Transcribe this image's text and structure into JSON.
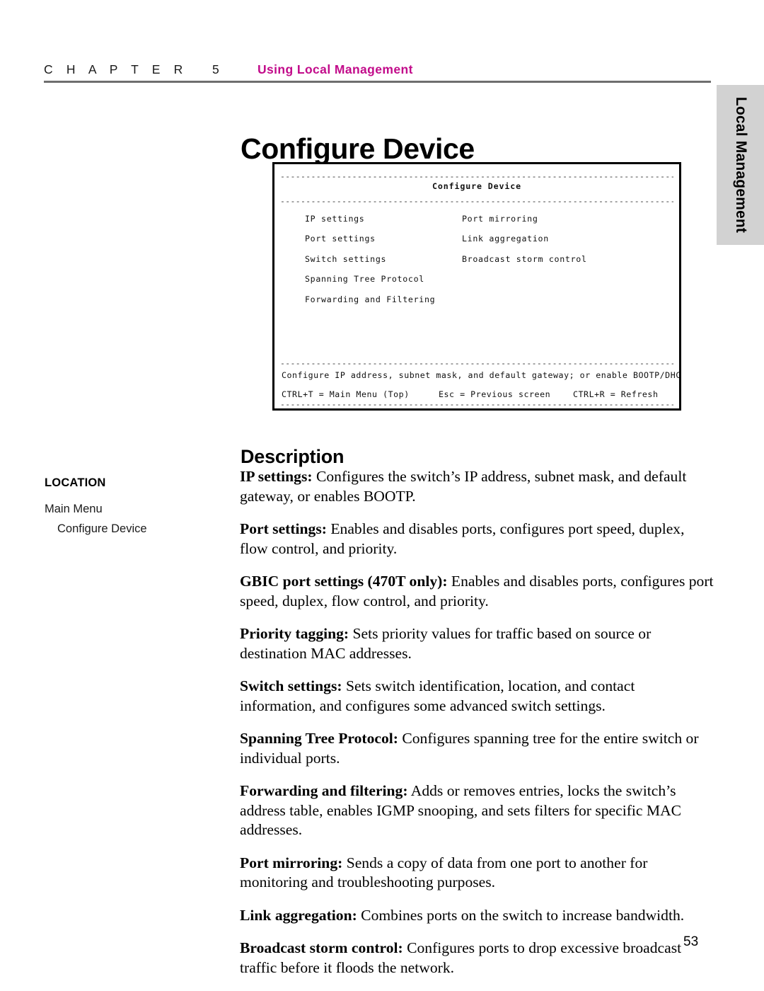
{
  "header": {
    "chapter_word": "C H A P T E R",
    "chapter_number": "5",
    "chapter_title": "Using Local Management",
    "accent_color": "#C20B8A",
    "rule_color": "#6E6E6E"
  },
  "side_tab": {
    "label": "Local Management",
    "background": "#D2D2D2"
  },
  "page_title": "Configure Device",
  "terminal": {
    "title": "Configure Device",
    "separator": "----------------------------------------------------------------------------------",
    "menu_left": [
      "IP settings",
      "Port settings",
      "Switch settings",
      "Spanning Tree Protocol",
      "Forwarding and Filtering"
    ],
    "menu_right": [
      "Port mirroring",
      "Link aggregation",
      "Broadcast storm control"
    ],
    "status_description": "Configure IP address, subnet mask, and default gateway; or enable BOOTP/DHCP.",
    "keys": [
      "CTRL+T = Main Menu (Top)",
      "Esc = Previous screen",
      "CTRL+R = Refresh"
    ]
  },
  "description": {
    "heading": "Description",
    "paragraphs": [
      {
        "term": "IP settings:",
        "text": " Configures the switch’s IP address, subnet mask, and default gateway, or enables BOOTP."
      },
      {
        "term": "Port settings:",
        "text": " Enables and disables ports, configures port speed, duplex, flow control, and priority."
      },
      {
        "term": "GBIC port settings (470T only):",
        "text": " Enables and disables ports, configures port speed, duplex, flow control, and priority."
      },
      {
        "term": "Priority tagging:",
        "text": " Sets priority values for traffic based on source or destination MAC addresses."
      },
      {
        "term": "Switch settings:",
        "text": " Sets switch identification, location, and contact information, and configures some advanced switch settings."
      },
      {
        "term": "Spanning Tree Protocol:",
        "text": " Configures spanning tree for the entire switch or individual ports."
      },
      {
        "term": "Forwarding and filtering:",
        "text": " Adds or removes entries, locks the switch’s address table, enables IGMP snooping, and sets filters for specific MAC addresses."
      },
      {
        "term": "Port mirroring:",
        "text": " Sends a copy of data from one port to another for monitoring and troubleshooting purposes."
      },
      {
        "term": "Link aggregation:",
        "text": " Combines ports on the switch to increase bandwidth."
      },
      {
        "term": "Broadcast storm control:",
        "text": " Configures ports to drop excessive broadcast traffic before it floods the network."
      }
    ]
  },
  "location": {
    "heading": "LOCATION",
    "items": [
      {
        "label": "Main Menu",
        "level": 1
      },
      {
        "label": "Configure Device",
        "level": 2
      }
    ]
  },
  "footer": {
    "page_number": "53"
  }
}
